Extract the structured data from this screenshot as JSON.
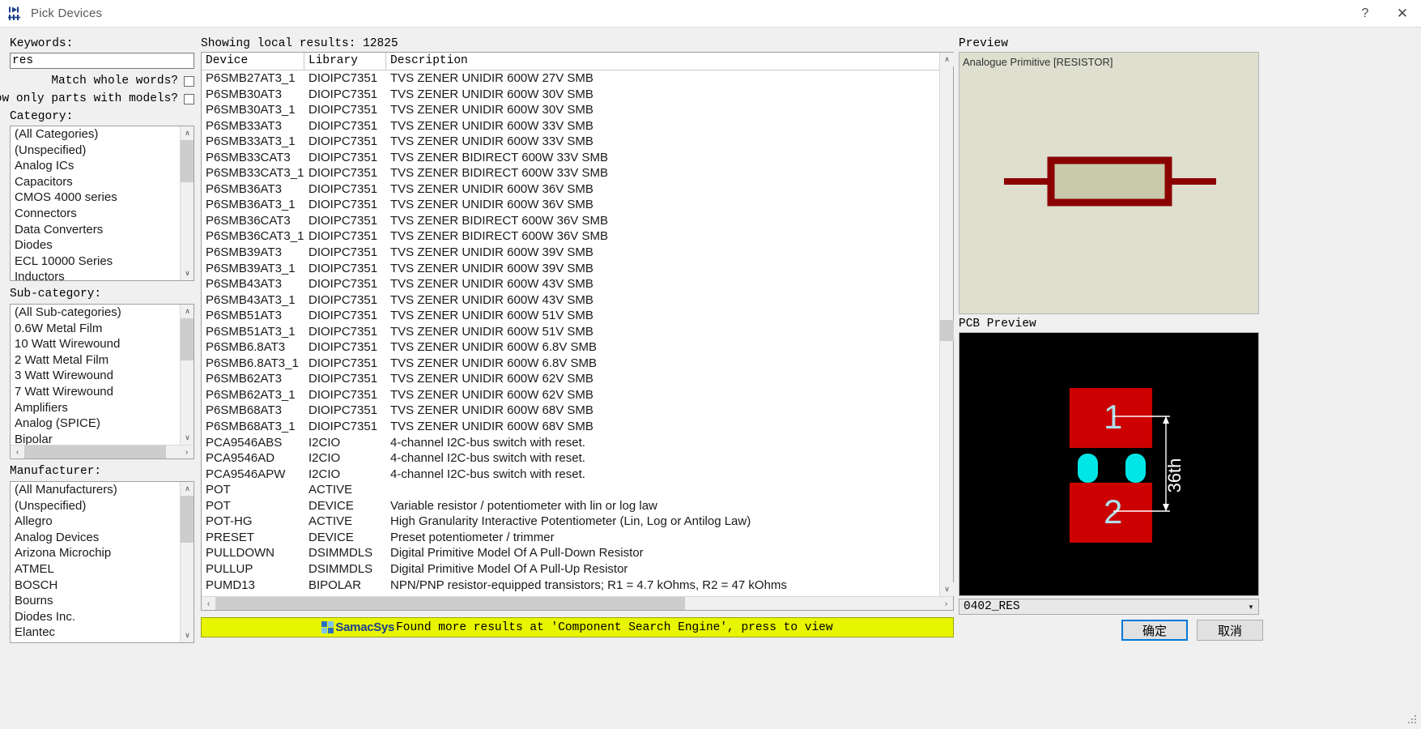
{
  "window": {
    "title": "Pick Devices",
    "icon": "pick-devices-icon",
    "help_glyph": "?",
    "close_glyph": "✕"
  },
  "left": {
    "keywords_label": "Keywords:",
    "keywords_value": "res",
    "keywords_placeholder": "",
    "match_whole_words_label": "Match whole words?",
    "match_whole_words_checked": false,
    "show_only_models_label": "Show only parts with models?",
    "show_only_models_checked": false,
    "category_label": "Category:",
    "categories": [
      "(All Categories)",
      "(Unspecified)",
      "Analog ICs",
      "Capacitors",
      "CMOS 4000 series",
      "Connectors",
      "Data Converters",
      "Diodes",
      "ECL 10000 Series",
      "Inductors"
    ],
    "subcategory_label": "Sub-category:",
    "subcategories": [
      "(All Sub-categories)",
      "0.6W Metal Film",
      "10 Watt Wirewound",
      "2 Watt Metal Film",
      "3 Watt Wirewound",
      "7 Watt Wirewound",
      "Amplifiers",
      "Analog (SPICE)",
      "Bipolar"
    ],
    "manufacturer_label": "Manufacturer:",
    "manufacturers": [
      "(All Manufacturers)",
      "(Unspecified)",
      "Allegro",
      "Analog Devices",
      "Arizona Microchip",
      "ATMEL",
      "BOSCH",
      "Bourns",
      "Diodes Inc.",
      "Elantec"
    ]
  },
  "results": {
    "status": "Showing local results: 12825",
    "columns": [
      "Device",
      "Library",
      "Description"
    ],
    "rows": [
      [
        "P6SMB27AT3_1",
        "DIOIPC7351",
        "TVS ZENER UNIDIR 600W 27V SMB"
      ],
      [
        "P6SMB30AT3",
        "DIOIPC7351",
        "TVS ZENER UNIDIR 600W 30V SMB"
      ],
      [
        "P6SMB30AT3_1",
        "DIOIPC7351",
        "TVS ZENER UNIDIR 600W 30V SMB"
      ],
      [
        "P6SMB33AT3",
        "DIOIPC7351",
        "TVS ZENER UNIDIR 600W 33V SMB"
      ],
      [
        "P6SMB33AT3_1",
        "DIOIPC7351",
        "TVS ZENER UNIDIR 600W 33V SMB"
      ],
      [
        "P6SMB33CAT3",
        "DIOIPC7351",
        "TVS ZENER BIDIRECT 600W 33V SMB"
      ],
      [
        "P6SMB33CAT3_1",
        "DIOIPC7351",
        "TVS ZENER BIDIRECT 600W 33V SMB"
      ],
      [
        "P6SMB36AT3",
        "DIOIPC7351",
        "TVS ZENER UNIDIR 600W 36V SMB"
      ],
      [
        "P6SMB36AT3_1",
        "DIOIPC7351",
        "TVS ZENER UNIDIR 600W 36V SMB"
      ],
      [
        "P6SMB36CAT3",
        "DIOIPC7351",
        "TVS ZENER BIDIRECT 600W 36V SMB"
      ],
      [
        "P6SMB36CAT3_1",
        "DIOIPC7351",
        "TVS ZENER BIDIRECT 600W 36V SMB"
      ],
      [
        "P6SMB39AT3",
        "DIOIPC7351",
        "TVS ZENER UNIDIR 600W 39V SMB"
      ],
      [
        "P6SMB39AT3_1",
        "DIOIPC7351",
        "TVS ZENER UNIDIR 600W 39V SMB"
      ],
      [
        "P6SMB43AT3",
        "DIOIPC7351",
        "TVS ZENER UNIDIR 600W 43V SMB"
      ],
      [
        "P6SMB43AT3_1",
        "DIOIPC7351",
        "TVS ZENER UNIDIR 600W 43V SMB"
      ],
      [
        "P6SMB51AT3",
        "DIOIPC7351",
        "TVS ZENER UNIDIR 600W 51V SMB"
      ],
      [
        "P6SMB51AT3_1",
        "DIOIPC7351",
        "TVS ZENER UNIDIR 600W 51V SMB"
      ],
      [
        "P6SMB6.8AT3",
        "DIOIPC7351",
        "TVS ZENER UNIDIR 600W 6.8V SMB"
      ],
      [
        "P6SMB6.8AT3_1",
        "DIOIPC7351",
        "TVS ZENER UNIDIR 600W 6.8V SMB"
      ],
      [
        "P6SMB62AT3",
        "DIOIPC7351",
        "TVS ZENER UNIDIR 600W 62V SMB"
      ],
      [
        "P6SMB62AT3_1",
        "DIOIPC7351",
        "TVS ZENER UNIDIR 600W 62V SMB"
      ],
      [
        "P6SMB68AT3",
        "DIOIPC7351",
        "TVS ZENER UNIDIR 600W 68V SMB"
      ],
      [
        "P6SMB68AT3_1",
        "DIOIPC7351",
        "TVS ZENER UNIDIR 600W 68V SMB"
      ],
      [
        "PCA9546ABS",
        "I2CIO",
        "4-channel I2C-bus switch with reset."
      ],
      [
        "PCA9546AD",
        "I2CIO",
        "4-channel I2C-bus switch with reset."
      ],
      [
        "PCA9546APW",
        "I2CIO",
        "4-channel I2C-bus switch with reset."
      ],
      [
        "POT",
        "ACTIVE",
        ""
      ],
      [
        "POT",
        "DEVICE",
        "Variable resistor / potentiometer with lin or log law"
      ],
      [
        "POT-HG",
        "ACTIVE",
        "High Granularity Interactive Potentiometer (Lin, Log or Antilog Law)"
      ],
      [
        "PRESET",
        "DEVICE",
        "Preset potentiometer / trimmer"
      ],
      [
        "PULLDOWN",
        "DSIMMDLS",
        "Digital Primitive Model Of A Pull-Down Resistor"
      ],
      [
        "PULLUP",
        "DSIMMDLS",
        "Digital Primitive Model Of A Pull-Up Resistor"
      ],
      [
        "PUMD13",
        "BIPOLAR",
        "NPN/PNP resistor-equipped transistors; R1 = 4.7 kOhms, R2 = 47 kOhms"
      ]
    ]
  },
  "banner": {
    "brand": "SamacSys",
    "icon": "samacsys-logo-icon",
    "text": "Found more results at 'Component Search Engine', press to view"
  },
  "preview": {
    "label": "Preview",
    "caption": "Analogue Primitive [RESISTOR]",
    "symbol_color": "#8b0000",
    "body_fill": "#c9c9ab",
    "background": "#dedfcf"
  },
  "pcb_preview": {
    "label": "PCB Preview",
    "pad_color": "#cc0000",
    "hole_color": "#00e5e5",
    "text_color": "#aee0ea",
    "pad_labels": [
      "1",
      "2"
    ],
    "dimension_text": "36th",
    "background": "#000000"
  },
  "footer": {
    "package_value": "0402_RES",
    "package_arrow": "▼",
    "ok_label": "确定",
    "cancel_label": "取消"
  },
  "scroll": {
    "up_glyph": "∧",
    "down_glyph": "∨",
    "left_glyph": "‹",
    "right_glyph": "›"
  }
}
